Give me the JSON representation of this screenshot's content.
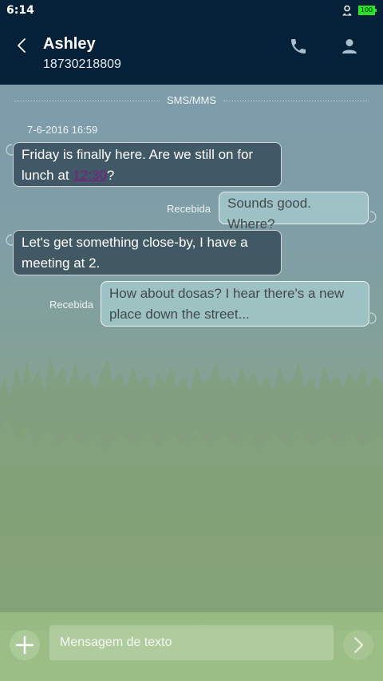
{
  "status_bar": {
    "time": "6:14",
    "battery": "100"
  },
  "header": {
    "contact_name": "Ashley",
    "contact_number": "18730218809"
  },
  "conversation": {
    "channel_label": "SMS/MMS",
    "date_label": "7-6-2016 16:59",
    "messages": [
      {
        "direction": "incoming",
        "text_before_link": "Friday is finally here. Are we still on for lunch at ",
        "link": "12:30",
        "text_after_link": "?"
      },
      {
        "direction": "outgoing",
        "status": "Recebida",
        "text": "Sounds good. Where?"
      },
      {
        "direction": "incoming",
        "text": "Let's get something close-by, I have a meeting at 2."
      },
      {
        "direction": "outgoing",
        "status": "Recebida",
        "text": "How about dosas? I hear there's a new place down the street..."
      }
    ]
  },
  "input_bar": {
    "placeholder": "Mensagem de texto",
    "value": ""
  },
  "icons": {
    "back": "chevron-left-icon",
    "call": "phone-icon",
    "contact": "person-icon",
    "add": "plus-icon",
    "send": "chevron-right-icon",
    "status_user": "user-badge-icon"
  },
  "colors": {
    "header_bg": "#052138",
    "incoming_bubble": "#2a3f4c",
    "outgoing_bubble": "#a6cccd",
    "link": "#7c1a86",
    "battery": "#29e129"
  }
}
